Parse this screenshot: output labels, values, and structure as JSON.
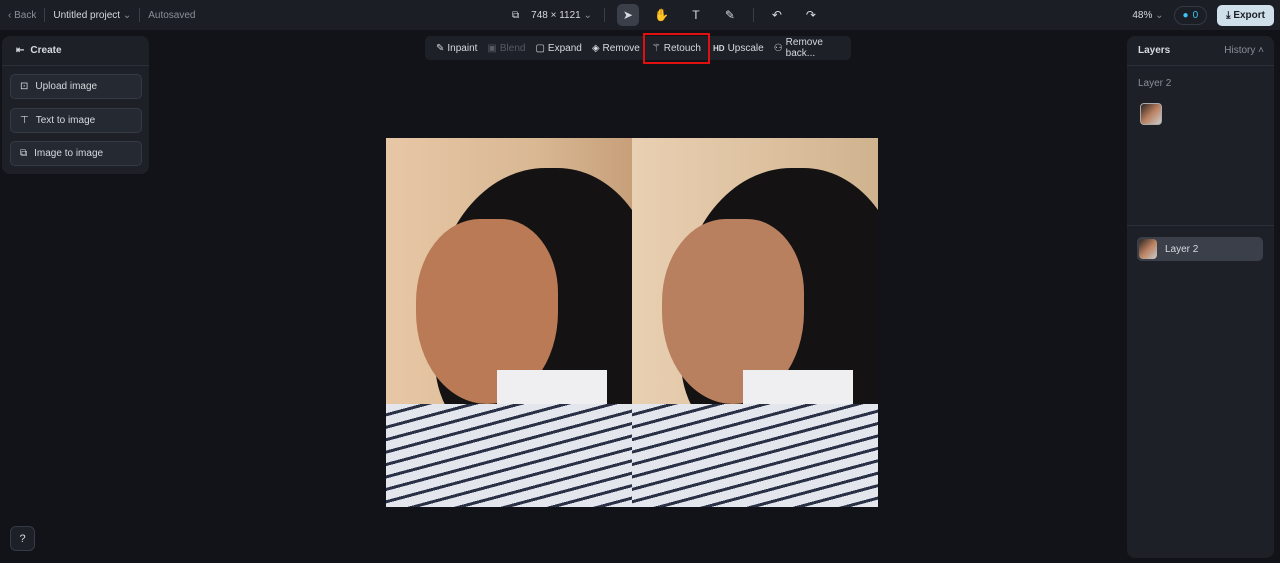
{
  "topbar": {
    "back": "Back",
    "project": "Untitled project",
    "status": "Autosaved",
    "dimensions": "748 × 1121",
    "zoom": "48%",
    "credits": "0",
    "export": "Export"
  },
  "create_panel": {
    "title": "Create",
    "items": [
      {
        "label": "Upload image",
        "icon": "upload-image-icon"
      },
      {
        "label": "Text to image",
        "icon": "text-to-image-icon"
      },
      {
        "label": "Image to image",
        "icon": "image-to-image-icon"
      }
    ]
  },
  "actions": [
    {
      "label": "Inpaint",
      "icon": "inpaint-icon"
    },
    {
      "label": "Blend",
      "icon": "blend-icon",
      "disabled": true
    },
    {
      "label": "Expand",
      "icon": "expand-icon"
    },
    {
      "label": "Remove",
      "icon": "eraser-icon"
    },
    {
      "label": "Retouch",
      "icon": "magic-wand-icon",
      "highlighted": true
    },
    {
      "label": "Upscale",
      "icon": "hd-icon",
      "prefix": "HD"
    },
    {
      "label": "Remove back...",
      "icon": "remove-background-icon"
    }
  ],
  "layers_panel": {
    "title": "Layers",
    "history": "History",
    "group_label": "Layer 2",
    "layer_item": "Layer 2"
  },
  "colors": {
    "highlight": "#e01010",
    "accent": "#3bc4f2",
    "export_bg": "#cfe0ea"
  }
}
